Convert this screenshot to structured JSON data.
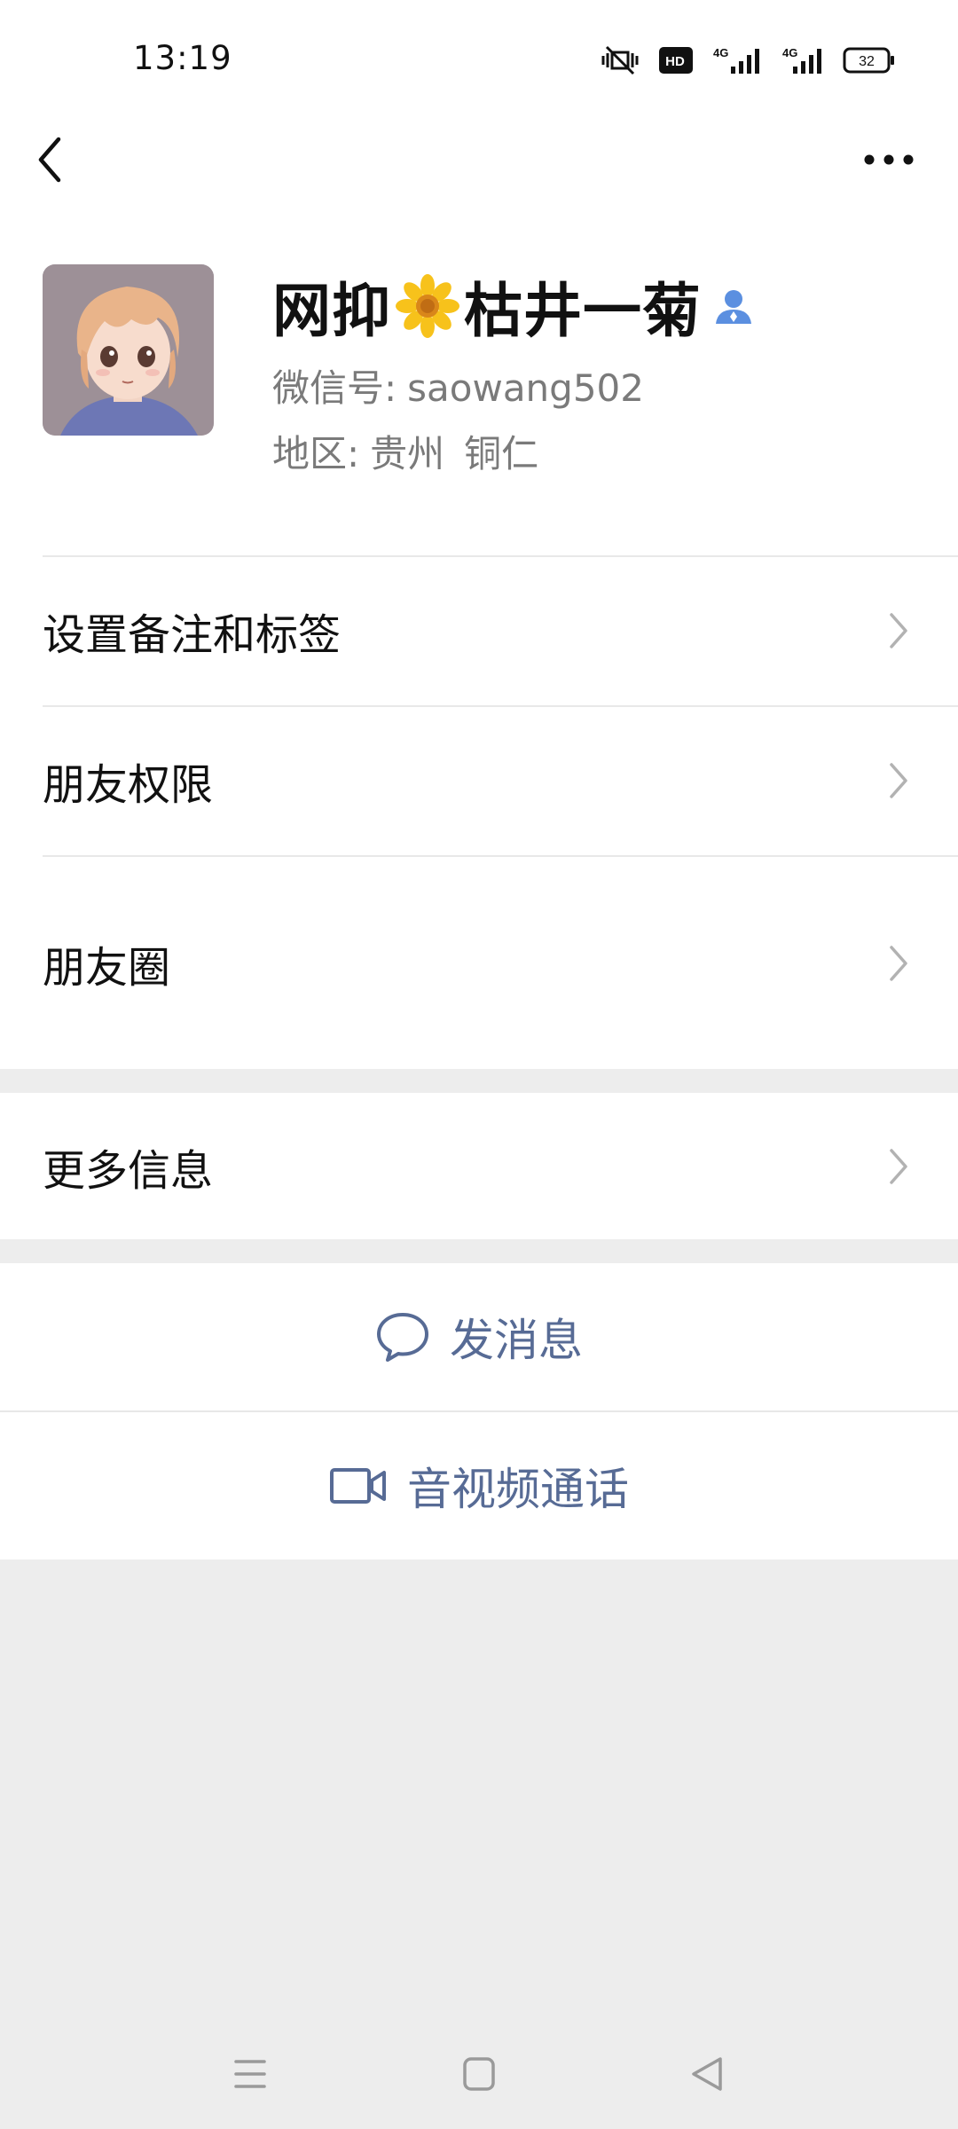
{
  "status_bar": {
    "time": "13:19",
    "network_1": "4G",
    "network_2": "4G",
    "battery": "32",
    "hd_label": "HD"
  },
  "header": {
    "back_icon": "chevron-left-icon",
    "more_icon": "more-dots-icon"
  },
  "profile": {
    "name_part1": "网抑",
    "name_part2": "枯井一菊",
    "wechat_id_label": "微信号:",
    "wechat_id_value": "saowang502",
    "region_label": "地区:",
    "region_province": "贵州",
    "region_city": "铜仁"
  },
  "menu": {
    "remark_label": "设置备注和标签",
    "permissions_label": "朋友权限",
    "moments_label": "朋友圈",
    "more_info_label": "更多信息"
  },
  "actions": {
    "message_label": "发消息",
    "call_label": "音视频通话"
  },
  "colors": {
    "link_blue": "#576b95",
    "background": "#ededed",
    "badge_blue": "#5b8fe0"
  }
}
